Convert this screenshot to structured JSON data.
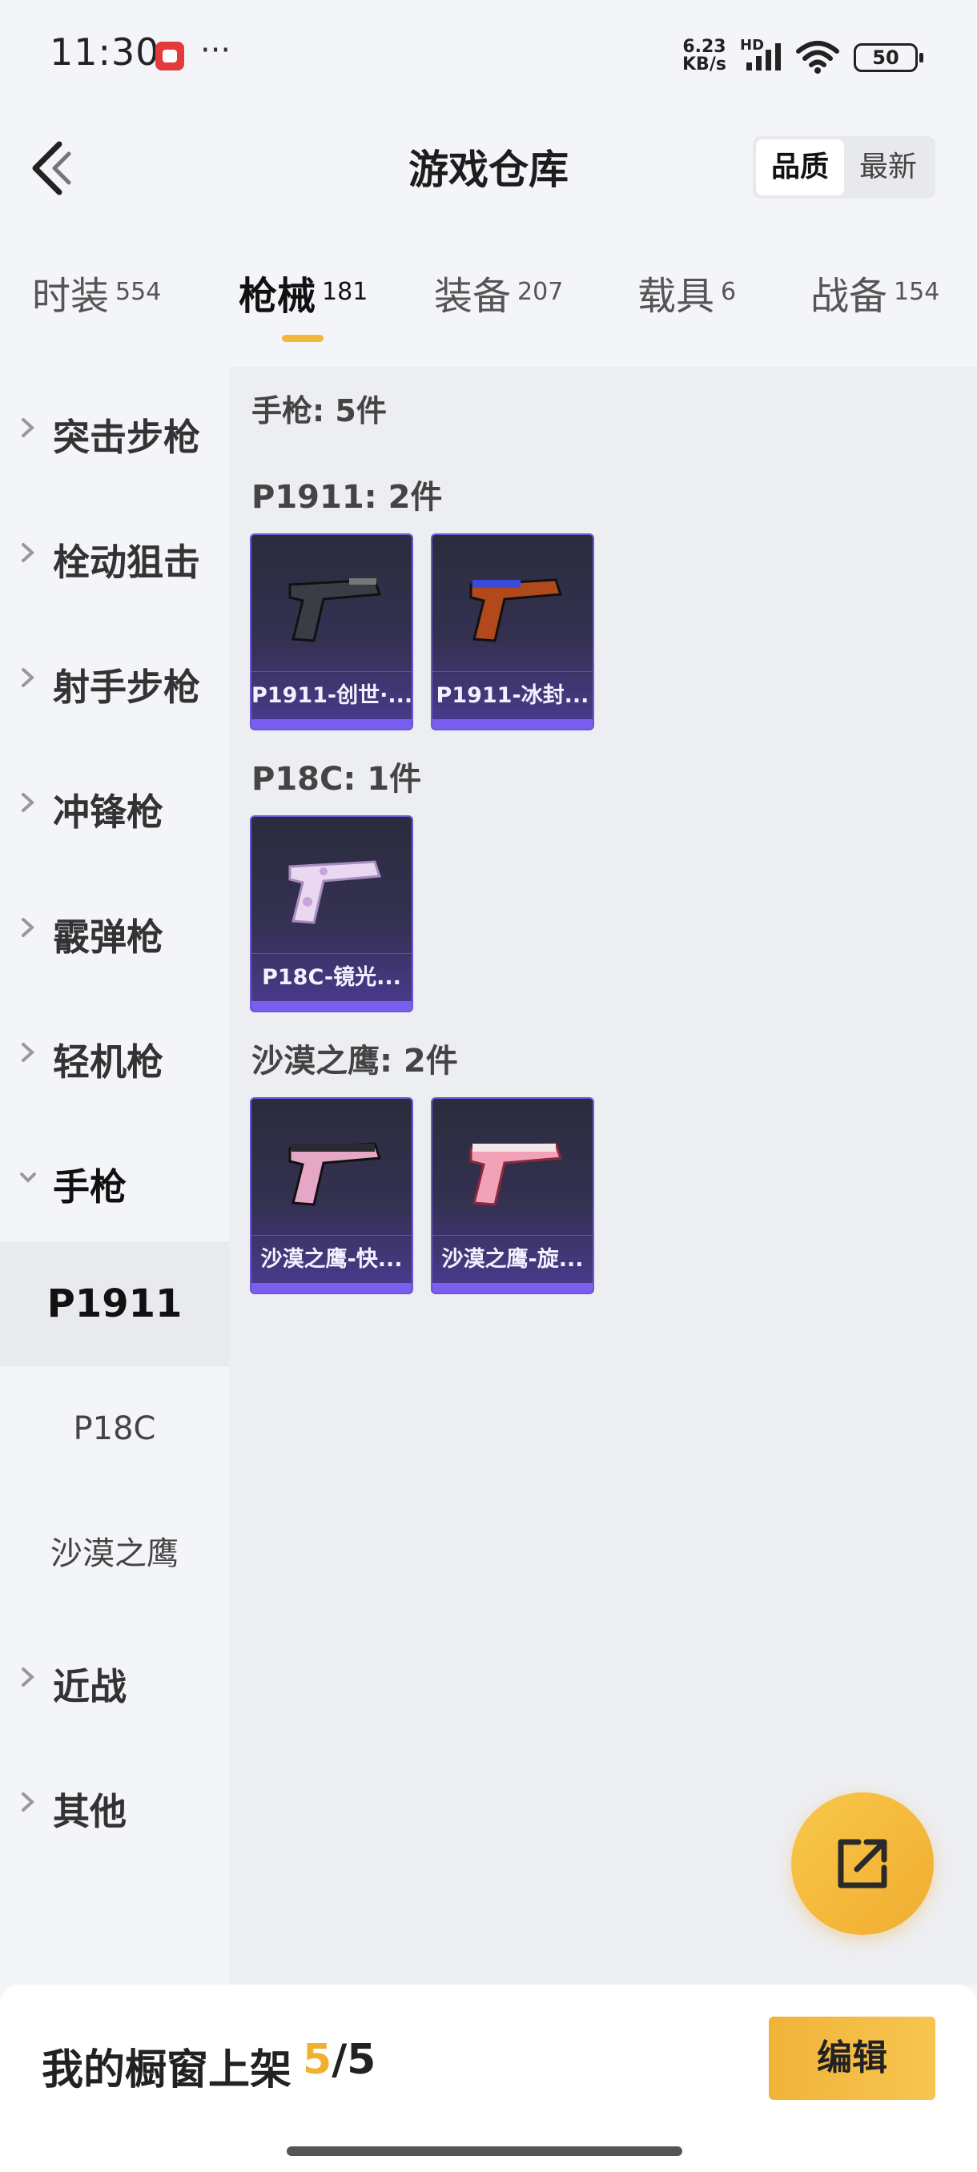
{
  "status_bar": {
    "time": "11:30",
    "more": "···",
    "net_speed_value": "6.23",
    "net_speed_unit": "KB/s",
    "network_type": "HD",
    "battery": "50"
  },
  "header": {
    "title": "游戏仓库",
    "sort_options": [
      "品质",
      "最新"
    ],
    "sort_active": "品质"
  },
  "tabs": [
    {
      "label": "时装",
      "count": "554"
    },
    {
      "label": "枪械",
      "count": "181",
      "active": true
    },
    {
      "label": "装备",
      "count": "207"
    },
    {
      "label": "载具",
      "count": "6"
    },
    {
      "label": "战备",
      "count": "154"
    }
  ],
  "sidebar": {
    "categories": [
      {
        "label": "突击步枪"
      },
      {
        "label": "栓动狙击"
      },
      {
        "label": "射手步枪"
      },
      {
        "label": "冲锋枪"
      },
      {
        "label": "霰弹枪"
      },
      {
        "label": "轻机枪"
      },
      {
        "label": "手枪",
        "expanded": true
      }
    ],
    "subitems": [
      {
        "label": "P1911",
        "active": true
      },
      {
        "label": "P18C"
      },
      {
        "label": "沙漠之鹰"
      }
    ],
    "tail_categories": [
      {
        "label": "近战"
      },
      {
        "label": "其他"
      }
    ]
  },
  "content": {
    "section_title": "手枪: 5件",
    "groups": [
      {
        "title": "P1911: 2件",
        "items": [
          {
            "name": "P1911-创世·...",
            "gun_color": "#3b3d46"
          },
          {
            "name": "P1911-冰封...",
            "gun_color": "#b2491c"
          }
        ]
      },
      {
        "title": "P18C: 1件",
        "items": [
          {
            "name": "P18C-镜光...",
            "gun_color": "#e9d8f0"
          }
        ]
      },
      {
        "title": "沙漠之鹰: 2件",
        "items": [
          {
            "name": "沙漠之鹰-快...",
            "gun_color": "#e6a6c6"
          },
          {
            "name": "沙漠之鹰-旋...",
            "gun_color": "#f1a2b8"
          }
        ]
      }
    ]
  },
  "bottom_bar": {
    "label": "我的橱窗上架",
    "current": "5",
    "total": "/5",
    "edit_label": "编辑"
  },
  "colors": {
    "accent": "#f2b83c",
    "card_border": "#6b58d6",
    "card_strip": "#7a5ef0"
  }
}
